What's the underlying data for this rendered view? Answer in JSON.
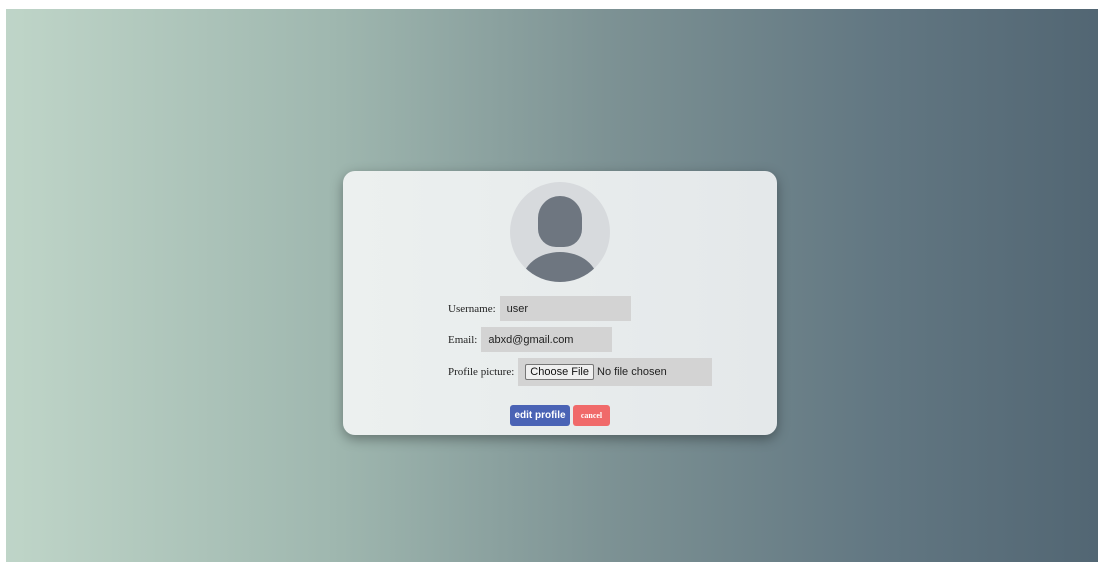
{
  "profile": {
    "username_label": "Username:",
    "username_value": "user",
    "email_label": "Email:",
    "email_value": "abxd@gmail.com",
    "picture_label": "Profile picture:",
    "choose_file_label": "Choose File",
    "no_file_text": "No file chosen"
  },
  "actions": {
    "edit_label": "edit profile",
    "cancel_label": "cancel"
  },
  "icons": {
    "avatar": "default-user-avatar-icon"
  },
  "colors": {
    "edit_button": "#4a63b5",
    "cancel_button": "#f06a6a",
    "field_background": "#d3d3d3",
    "avatar_background": "#d7dadd",
    "avatar_silhouette": "#6e7680"
  }
}
